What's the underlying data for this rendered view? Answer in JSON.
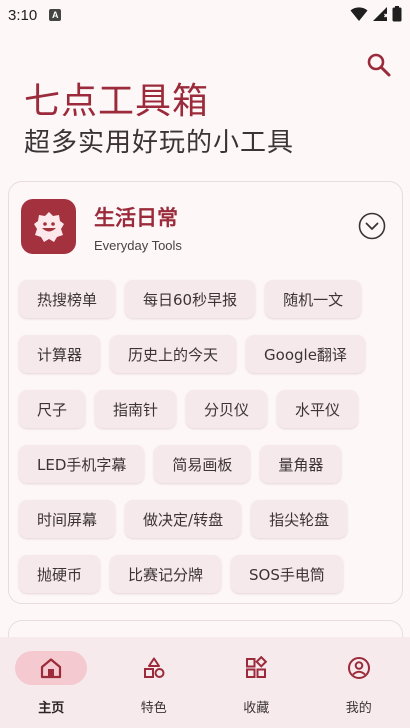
{
  "status_bar": {
    "time": "3:10",
    "notification_letter": "A"
  },
  "header": {
    "title": "七点工具箱",
    "subtitle": "超多实用好玩的小工具"
  },
  "category": {
    "title": "生活日常",
    "subtitle": "Everyday Tools",
    "rows": [
      [
        "热搜榜单",
        "每日60秒早报",
        "随机一文"
      ],
      [
        "计算器",
        "历史上的今天",
        "Google翻译"
      ],
      [
        "尺子",
        "指南针",
        "分贝仪",
        "水平仪"
      ],
      [
        "LED手机字幕",
        "简易画板",
        "量角器"
      ],
      [
        "时间屏幕",
        "做决定/转盘",
        "指尖轮盘"
      ],
      [
        "抛硬币",
        "比赛记分牌",
        "SOS手电筒"
      ]
    ]
  },
  "nav": [
    {
      "label": "主页",
      "icon": "home-icon",
      "active": true
    },
    {
      "label": "特色",
      "icon": "shapes-icon",
      "active": false
    },
    {
      "label": "收藏",
      "icon": "widgets-icon",
      "active": false
    },
    {
      "label": "我的",
      "icon": "account-icon",
      "active": false
    }
  ],
  "colors": {
    "accent": "#9b2b3a",
    "icon_bg": "#a4313e",
    "chip_bg": "#f6e9eb",
    "nav_bg": "#f6eaed",
    "nav_active": "#f4c9cf"
  }
}
